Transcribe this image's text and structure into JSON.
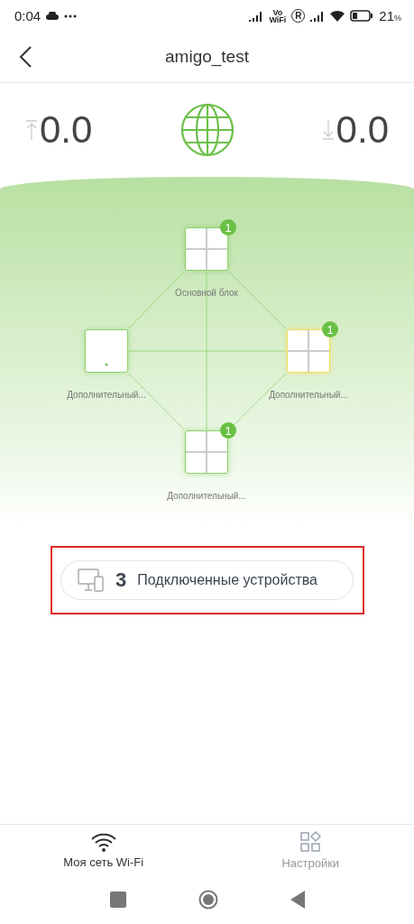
{
  "status_bar": {
    "time": "0:04",
    "vowifi_top": "Vo",
    "vowifi_bottom": "WiFi",
    "roaming": "R",
    "battery": "21",
    "battery_unit": "%"
  },
  "header": {
    "title": "amigo_test"
  },
  "speed": {
    "upload": "0.0",
    "download": "0.0"
  },
  "mesh": {
    "nodes": [
      {
        "label": "Основной блок",
        "kind": "quad",
        "badge": "1",
        "highlighted": false
      },
      {
        "label": "Дополнительный...",
        "kind": "single",
        "highlighted": false
      },
      {
        "label": "Дополнительный...",
        "kind": "quad",
        "badge": "1",
        "highlighted": true
      },
      {
        "label": "Дополнительный...",
        "kind": "quad",
        "badge": "1",
        "highlighted": false
      }
    ]
  },
  "devices": {
    "count": "3",
    "label": "Подключенные устройства",
    "framed": true
  },
  "bottom_nav": [
    {
      "label": "Моя сеть Wi-Fi",
      "kind": "wifi",
      "selected": true
    },
    {
      "label": "Настройки",
      "kind": "settings",
      "selected": false
    }
  ]
}
